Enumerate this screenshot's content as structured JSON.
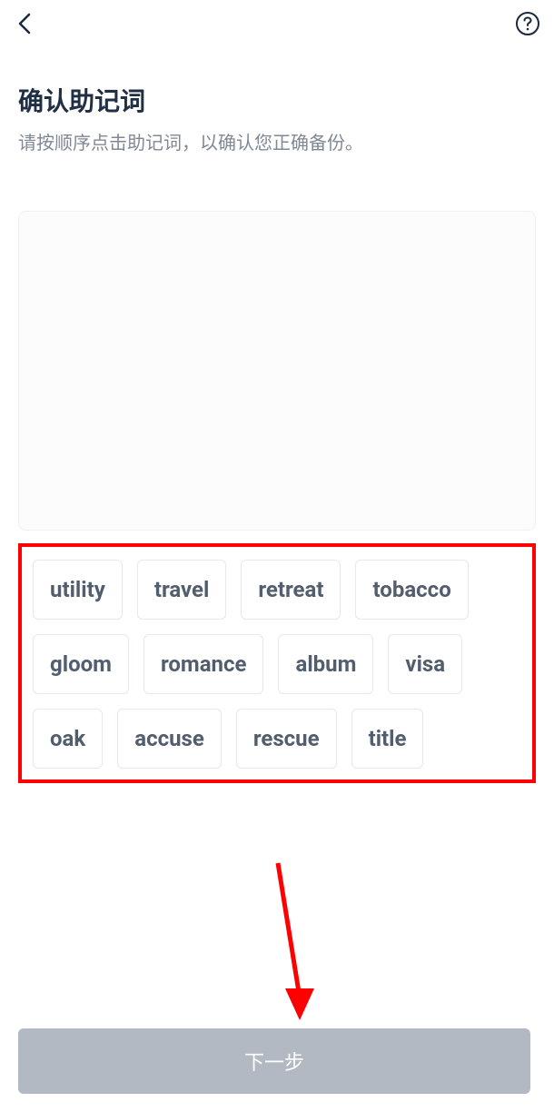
{
  "header": {
    "back_icon": "back-icon",
    "help_icon": "help-icon"
  },
  "page": {
    "title": "确认助记词",
    "subtitle": "请按顺序点击助记词，以确认您正确备份。"
  },
  "words": [
    "utility",
    "travel",
    "retreat",
    "tobacco",
    "gloom",
    "romance",
    "album",
    "visa",
    "oak",
    "accuse",
    "rescue",
    "title"
  ],
  "footer": {
    "next_label": "下一步"
  },
  "annotation": {
    "highlight_color": "#ff0000",
    "arrow_color": "#ff0000"
  }
}
